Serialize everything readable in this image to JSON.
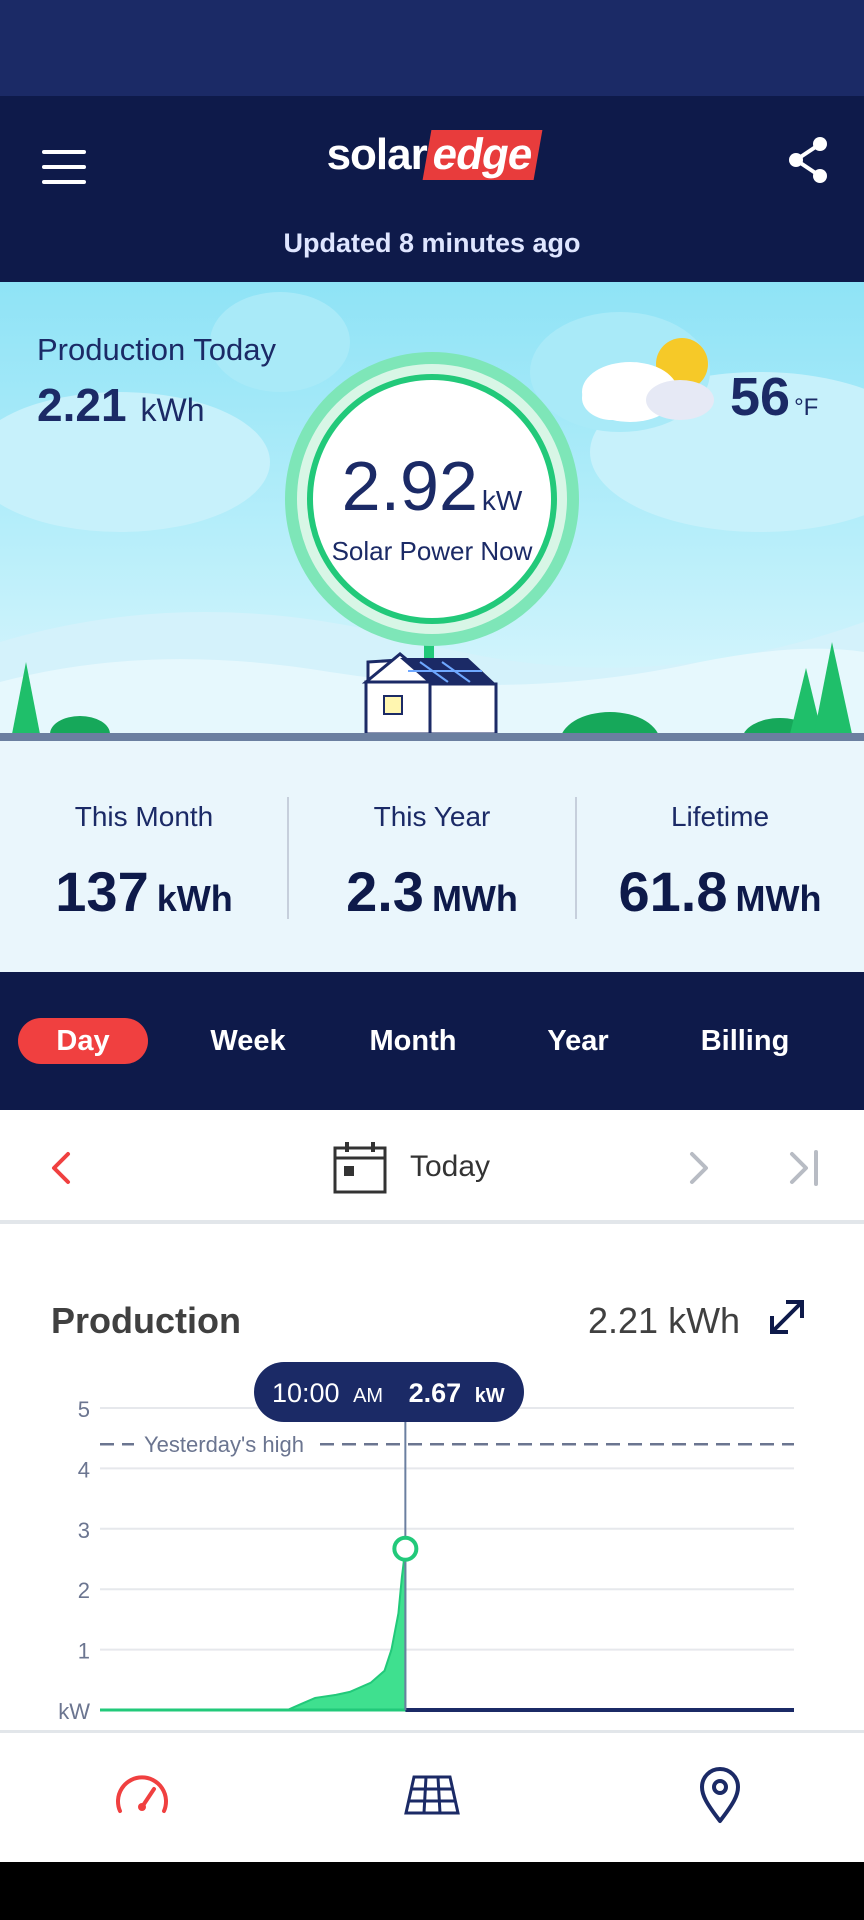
{
  "colors": {
    "header_bg": "#0e1a4a",
    "status_bar_bg": "#1b2a66",
    "accent_red": "#f04040",
    "production_green": "#22c97a",
    "stats_bg": "#eaf6fc"
  },
  "header": {
    "logo_part1": "solar",
    "logo_part2": "edge",
    "updated_text": "Updated 8 minutes ago",
    "menu_icon": "hamburger-menu-icon",
    "share_icon": "share-icon"
  },
  "hero": {
    "production_today_label": "Production Today",
    "production_today_value": "2.21",
    "production_today_unit": "kWh",
    "power_now_value": "2.92",
    "power_now_unit": "kW",
    "power_now_label": "Solar Power Now",
    "weather_temp": "56",
    "weather_unit": "°F",
    "weather_icon": "partly-cloudy-icon"
  },
  "stats": [
    {
      "label": "This Month",
      "value": "137",
      "unit": "kWh"
    },
    {
      "label": "This Year",
      "value": "2.3",
      "unit": "MWh"
    },
    {
      "label": "Lifetime",
      "value": "61.8",
      "unit": "MWh"
    }
  ],
  "tabs": [
    {
      "label": "Day",
      "active": true
    },
    {
      "label": "Week",
      "active": false
    },
    {
      "label": "Month",
      "active": false
    },
    {
      "label": "Year",
      "active": false
    },
    {
      "label": "Billing",
      "active": false
    }
  ],
  "date_nav": {
    "label": "Today",
    "prev_icon": "chevron-left-icon",
    "next_icon": "chevron-right-icon",
    "last_icon": "skip-to-end-icon",
    "calendar_icon": "calendar-icon"
  },
  "production_chart": {
    "title": "Production",
    "total": "2.21 kWh",
    "expand_icon": "expand-icon",
    "tooltip_time": "10:00",
    "tooltip_ampm": "AM",
    "tooltip_value": "2.67",
    "tooltip_unit": "kW",
    "reference_label": "Yesterday's high"
  },
  "chart_data": {
    "type": "area",
    "ylabel": "kW",
    "ylim": [
      0,
      5
    ],
    "yticks": [
      "kW",
      "1",
      "2",
      "3",
      "4",
      "5"
    ],
    "grid": true,
    "reference_line": {
      "label": "Yesterday's high",
      "value": 4.4
    },
    "series": [
      {
        "name": "Production",
        "x_fraction": [
          0.0,
          0.27,
          0.29,
          0.31,
          0.34,
          0.36,
          0.39,
          0.41,
          0.42,
          0.43,
          0.435,
          0.44
        ],
        "values": [
          0.0,
          0.0,
          0.1,
          0.2,
          0.25,
          0.3,
          0.45,
          0.65,
          1.0,
          1.6,
          2.2,
          2.67
        ]
      }
    ],
    "highlight": {
      "x_fraction": 0.44,
      "value": 2.67
    }
  },
  "bottom_nav": [
    {
      "icon": "dashboard-gauge-icon",
      "active": true
    },
    {
      "icon": "solar-panel-layout-icon",
      "active": false
    },
    {
      "icon": "location-pin-icon",
      "active": false
    }
  ]
}
